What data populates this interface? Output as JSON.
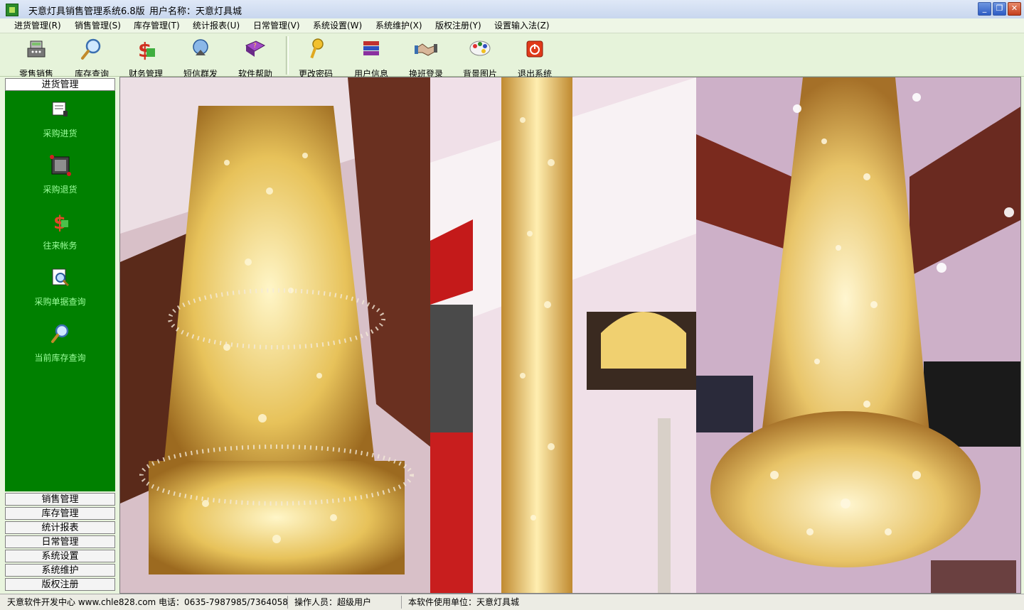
{
  "window": {
    "title": "天意灯具销售管理系统6.8版",
    "user_label": "用户名称：天意灯具城",
    "buttons": [
      "_",
      "❐",
      "✕"
    ]
  },
  "menu": [
    {
      "label": "进货管理(R)"
    },
    {
      "label": "销售管理(S)"
    },
    {
      "label": "库存管理(T)"
    },
    {
      "label": "统计报表(U)"
    },
    {
      "label": "日常管理(V)"
    },
    {
      "label": "系统设置(W)"
    },
    {
      "label": "系统维护(X)"
    },
    {
      "label": "版权注册(Y)"
    },
    {
      "label": "设置输入法(Z)"
    }
  ],
  "toolbar": [
    {
      "label": "零售销售",
      "icon": "cash-register-icon"
    },
    {
      "label": "库存查询",
      "icon": "magnifier-icon"
    },
    {
      "label": "财务管理",
      "icon": "dollar-icon"
    },
    {
      "label": "短信群发",
      "icon": "satellite-icon"
    },
    {
      "label": "软件帮助",
      "icon": "help-book-icon"
    },
    {
      "label": "更改密码",
      "icon": "key-icon"
    },
    {
      "label": "用户信息",
      "icon": "books-icon"
    },
    {
      "label": "换班登录",
      "icon": "handshake-icon"
    },
    {
      "label": "背景图片",
      "icon": "palette-icon"
    },
    {
      "label": "退出系统",
      "icon": "power-icon"
    }
  ],
  "sidebar": {
    "active_group": "进货管理",
    "items": [
      {
        "label": "采购进货",
        "icon": "purchase-book-icon"
      },
      {
        "label": "采购退货",
        "icon": "return-goods-icon"
      },
      {
        "label": "往来帐务",
        "icon": "accounts-dollar-icon"
      },
      {
        "label": "采购单据查询",
        "icon": "document-search-icon"
      },
      {
        "label": "当前库存查询",
        "icon": "stock-search-icon"
      }
    ],
    "groups": [
      "销售管理",
      "库存管理",
      "统计报表",
      "日常管理",
      "系统设置",
      "系统维护",
      "版权注册"
    ]
  },
  "status": {
    "company": "天意软件开发中心 www.chle828.com 电话：0635-7987985/7364058",
    "operator": "操作人员：超级用户",
    "unit": "本软件使用单位：天意灯具城"
  },
  "colors": {
    "sidebar_panel": "#008000",
    "sidebar_text": "#9dff9d",
    "background": "#e9f5de"
  }
}
